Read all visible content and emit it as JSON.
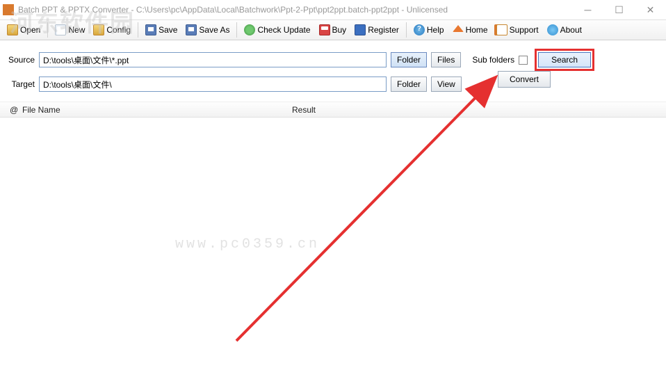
{
  "window": {
    "title": "Batch PPT & PPTX Converter - C:\\Users\\pc\\AppData\\Local\\Batchwork\\Ppt-2-Ppt\\ppt2ppt.batch-ppt2ppt - Unlicensed"
  },
  "toolbar": {
    "open": "Open",
    "new": "New",
    "config": "Config",
    "save": "Save",
    "saveas": "Save As",
    "checkupdate": "Check Update",
    "buy": "Buy",
    "register": "Register",
    "help": "Help",
    "home": "Home",
    "support": "Support",
    "about": "About"
  },
  "form": {
    "source_label": "Source",
    "source_value": "D:\\tools\\桌面\\文件\\*.ppt",
    "target_label": "Target",
    "target_value": "D:\\tools\\桌面\\文件\\",
    "folder_btn": "Folder",
    "files_btn": "Files",
    "view_btn": "View",
    "subfolders_label": "Sub folders",
    "search_btn": "Search",
    "convert_btn": "Convert"
  },
  "table": {
    "col_at": "@",
    "col_filename": "File Name",
    "col_result": "Result"
  },
  "watermark": {
    "wm1": "河东软件园",
    "wm2": "www.pc0359.cn"
  }
}
